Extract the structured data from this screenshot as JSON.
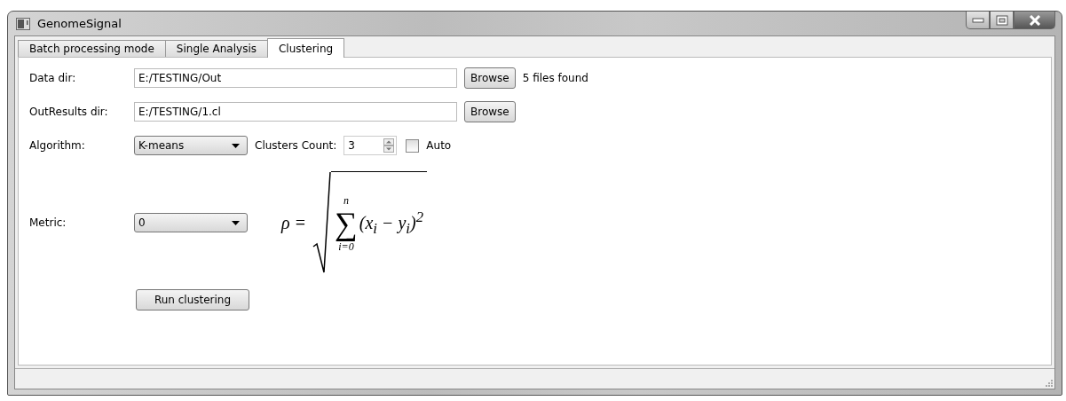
{
  "window": {
    "title": "GenomeSignal"
  },
  "tabs": [
    {
      "label": "Batch processing mode",
      "selected": false
    },
    {
      "label": "Single Analysis",
      "selected": false
    },
    {
      "label": "Clustering",
      "selected": true
    }
  ],
  "form": {
    "data_dir": {
      "label": "Data dir:",
      "value": "E:/TESTING/Out",
      "button": "Browse",
      "status": "5 files found"
    },
    "out_dir": {
      "label": "OutResults dir:",
      "value": "E:/TESTING/1.cl",
      "button": "Browse"
    },
    "algorithm": {
      "label": "Algorithm:",
      "value": "K-means"
    },
    "clusters_count": {
      "label": "Clusters Count:",
      "value": "3"
    },
    "auto": {
      "label": "Auto",
      "checked": false
    },
    "metric": {
      "label": "Metric:",
      "value": "0"
    },
    "formula": {
      "lhs": "ρ =",
      "sum_upper": "n",
      "sum_sign": "∑",
      "sum_lower": "i=0",
      "body": "(x$_{i}$ − y$_{i}$)$^{2}$"
    },
    "run_button": "Run clustering"
  }
}
